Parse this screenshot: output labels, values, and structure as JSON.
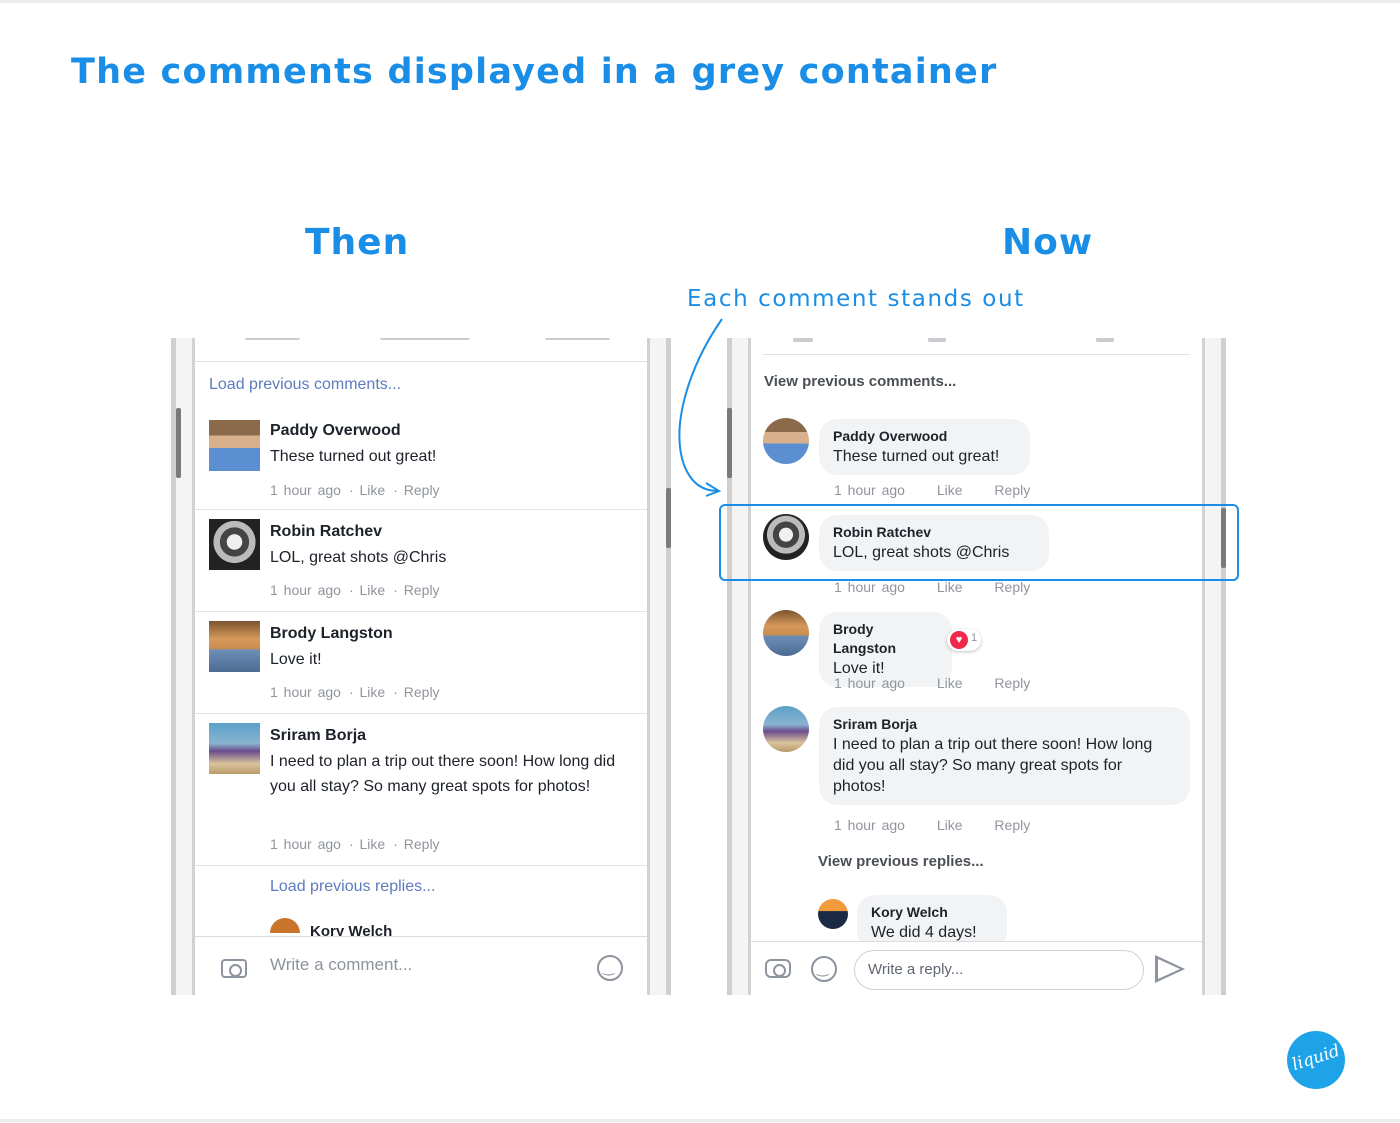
{
  "slide": {
    "title": "The comments displayed in a grey container",
    "then_label": "Then",
    "now_label": "Now",
    "annotation": "Each comment stands out",
    "logo_text": "liquid",
    "accent_color": "#1a8ee6"
  },
  "then": {
    "load_previous": "Load previous comments...",
    "comments": [
      {
        "name": "Paddy Overwood",
        "text": "These turned out great!",
        "time": "1 hour ago",
        "like": "Like",
        "reply": "Reply"
      },
      {
        "name": "Robin Ratchev",
        "text": "LOL, great shots @Chris",
        "time": "1 hour ago",
        "like": "Like",
        "reply": "Reply"
      },
      {
        "name": "Brody Langston",
        "text": "Love it!",
        "time": "1 hour ago",
        "like": "Like",
        "reply": "Reply"
      },
      {
        "name": "Sriram Borja",
        "text": "I need to plan a trip out there soon! How long did you all stay? So many great spots for photos!",
        "time": "1 hour ago",
        "like": "Like",
        "reply": "Reply"
      }
    ],
    "load_replies": "Load previous replies...",
    "partial_reply_name": "Kory Welch",
    "input_placeholder": "Write a comment..."
  },
  "now": {
    "view_previous": "View previous comments...",
    "comments": [
      {
        "name": "Paddy Overwood",
        "text": "These turned out great!",
        "time": "1 hour ago",
        "like": "Like",
        "reply": "Reply"
      },
      {
        "name": "Robin Ratchev",
        "text": "LOL, great shots @Chris",
        "time": "1 hour ago",
        "like": "Like",
        "reply": "Reply"
      },
      {
        "name": "Brody Langston",
        "text": "Love it!",
        "time": "1 hour ago",
        "like": "Like",
        "reply": "Reply",
        "reaction_count": "1"
      },
      {
        "name": "Sriram Borja",
        "text": "I need to plan a trip out there soon! How long did you all stay? So many great spots for photos!",
        "time": "1 hour ago",
        "like": "Like",
        "reply": "Reply"
      }
    ],
    "view_replies": "View previous replies...",
    "reply": {
      "name": "Kory Welch",
      "text": "We did 4 days!"
    },
    "input_placeholder": "Write a reply..."
  }
}
